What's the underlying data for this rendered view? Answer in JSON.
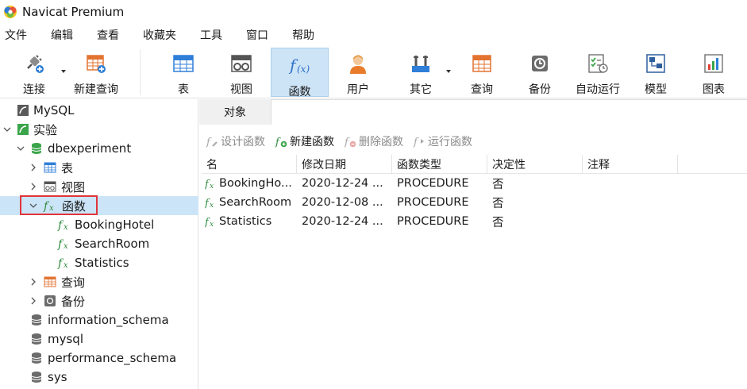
{
  "window": {
    "title": "Navicat Premium"
  },
  "menu": [
    "文件",
    "编辑",
    "查看",
    "收藏夹",
    "工具",
    "窗口",
    "帮助"
  ],
  "toolbar": {
    "connect": "连接",
    "new_query": "新建查询",
    "table": "表",
    "view": "视图",
    "function": "函数",
    "user": "用户",
    "other": "其它",
    "query": "查询",
    "backup": "备份",
    "automation": "自动运行",
    "model": "模型",
    "chart": "图表"
  },
  "tree": {
    "conn_mysql": "MySQL",
    "conn_experiment": "实验",
    "db_experiment": "dbexperiment",
    "tables": "表",
    "views": "视图",
    "functions": "函数",
    "fn_booking": "BookingHotel",
    "fn_search": "SearchRoom",
    "fn_stats": "Statistics",
    "queries": "查询",
    "backups": "备份",
    "db_info": "information_schema",
    "db_mysql": "mysql",
    "db_perf": "performance_schema",
    "db_sys": "sys"
  },
  "tabs": {
    "objects": "对象"
  },
  "actions": {
    "design": "设计函数",
    "new": "新建函数",
    "delete": "删除函数",
    "run": "运行函数"
  },
  "grid": {
    "headers": [
      "名",
      "修改日期",
      "函数类型",
      "决定性",
      "注释"
    ],
    "rows": [
      {
        "name": "BookingHo...",
        "date": "2020-12-24 ...",
        "type": "PROCEDURE",
        "deterministic": "否",
        "comment": ""
      },
      {
        "name": "SearchRoom",
        "date": "2020-12-08 ...",
        "type": "PROCEDURE",
        "deterministic": "否",
        "comment": ""
      },
      {
        "name": "Statistics",
        "date": "2020-12-24 ...",
        "type": "PROCEDURE",
        "deterministic": "否",
        "comment": ""
      }
    ]
  },
  "colors": {
    "selection": "#cce4f7",
    "active_tool": "#cde4f7",
    "highlight_border": "#e0343b",
    "function_green": "#2e8b3d",
    "db_green": "#3aa54a"
  },
  "icons": [
    "navicat-logo-icon",
    "plug-icon",
    "new-query-icon",
    "table-icon",
    "view-icon",
    "function-icon",
    "user-icon",
    "other-tools-icon",
    "query-icon",
    "backup-icon",
    "automation-icon",
    "model-icon",
    "chart-icon",
    "mysql-connection-icon",
    "database-icon",
    "chevron-right-icon",
    "chevron-down-icon"
  ]
}
